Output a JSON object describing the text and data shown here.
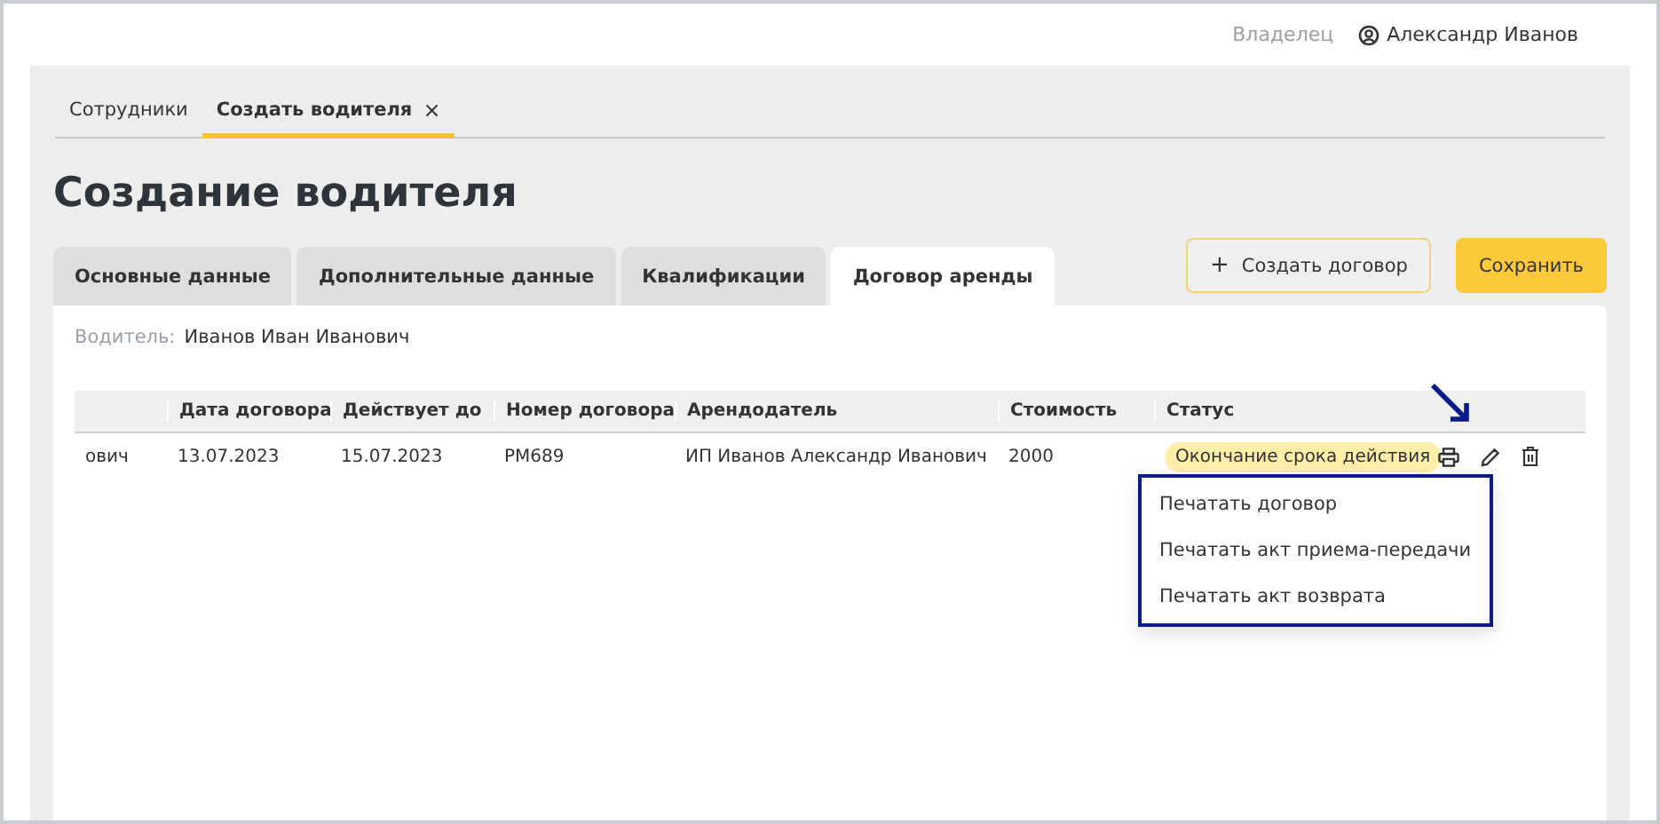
{
  "header": {
    "role": "Владелец",
    "user": "Александр Иванов"
  },
  "page_tabs": [
    {
      "label": "Сотрудники",
      "selected": false
    },
    {
      "label": "Создать водителя",
      "selected": true,
      "close": "×"
    }
  ],
  "title": "Создание водителя",
  "form_tabs": [
    {
      "label": "Основные данные",
      "selected": false
    },
    {
      "label": "Дополнительные данные",
      "selected": false
    },
    {
      "label": "Квалификации",
      "selected": false
    },
    {
      "label": "Договор аренды",
      "selected": true
    }
  ],
  "actions": [
    {
      "label": "Создать договор",
      "kind": "outline",
      "icon": "+"
    },
    {
      "label": "Сохранить",
      "kind": "primary"
    }
  ],
  "driver": {
    "label": "Водитель:",
    "value": "Иванов Иван Иванович"
  },
  "table": {
    "columns": [
      "",
      "Дата договора",
      "Действует до",
      "Номер договора",
      "Арендодатель",
      "Стоимость",
      "Статус"
    ],
    "rows": [
      {
        "cells": [
          "ович",
          "13.07.2023",
          "15.07.2023",
          "РМ689",
          "ИП Иванов Александр Иванович",
          "2000"
        ],
        "status": "Окончание срока действия"
      }
    ]
  },
  "print_menu": [
    "Печатать договор",
    "Печатать акт приема-передачи",
    "Печатать акт возврата"
  ]
}
